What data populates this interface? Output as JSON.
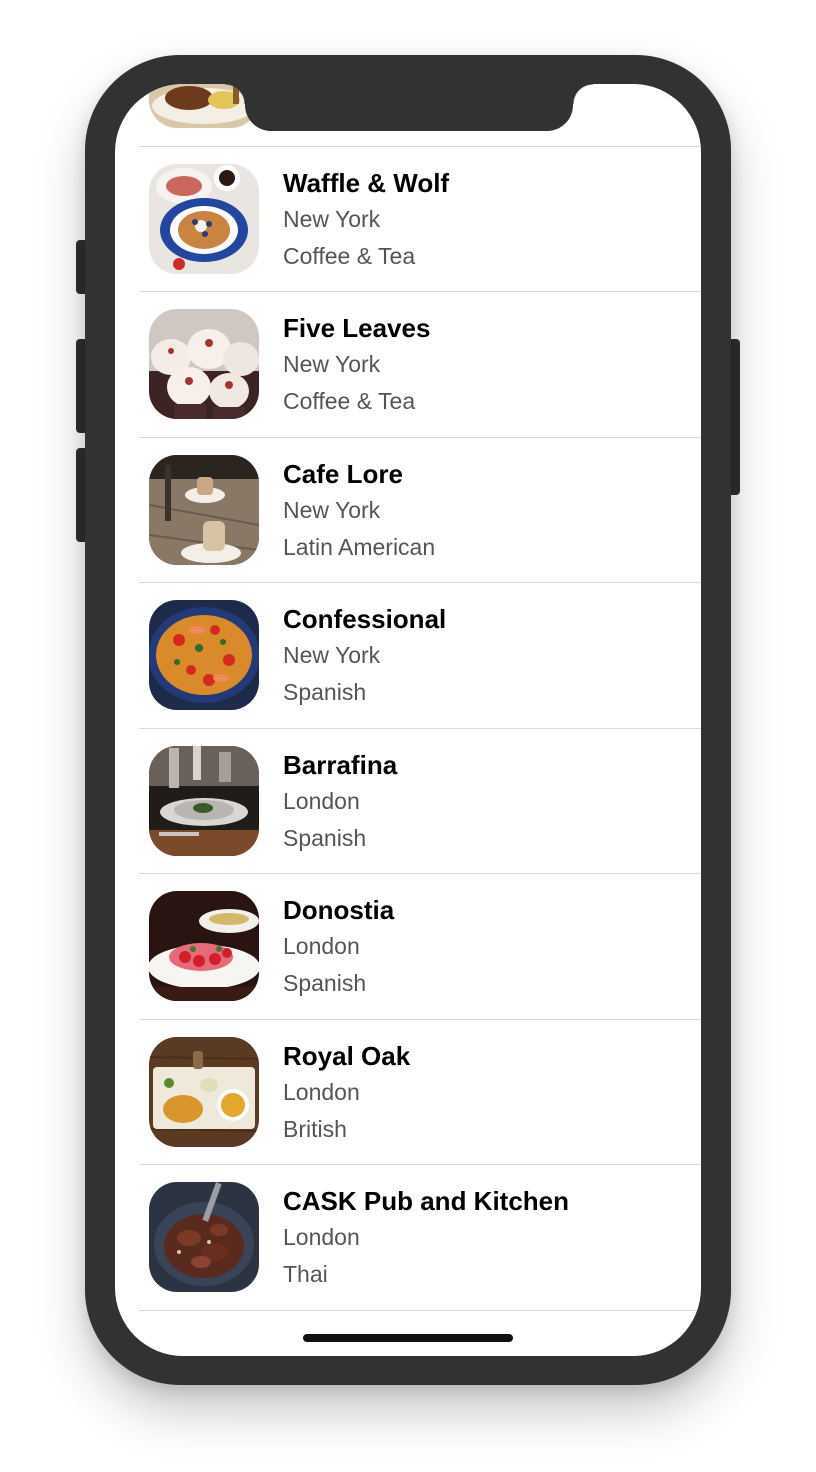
{
  "restaurants": [
    {
      "name": "",
      "city": "",
      "cuisine": "",
      "image": "food-photo-plate"
    },
    {
      "name": "Waffle & Wolf",
      "city": "New York",
      "cuisine": "Coffee & Tea",
      "image": "waffle-photo"
    },
    {
      "name": "Five Leaves",
      "city": "New York",
      "cuisine": "Coffee & Tea",
      "image": "cupcakes-photo"
    },
    {
      "name": "Cafe Lore",
      "city": "New York",
      "cuisine": "Latin American",
      "image": "coffee-table-photo"
    },
    {
      "name": "Confessional",
      "city": "New York",
      "cuisine": "Spanish",
      "image": "paella-photo"
    },
    {
      "name": "Barrafina",
      "city": "London",
      "cuisine": "Spanish",
      "image": "restaurant-plate-photo"
    },
    {
      "name": "Donostia",
      "city": "London",
      "cuisine": "Spanish",
      "image": "strawberry-dessert-photo"
    },
    {
      "name": "Royal Oak",
      "city": "London",
      "cuisine": "British",
      "image": "fish-and-chips-photo"
    },
    {
      "name": "CASK Pub and Kitchen",
      "city": "London",
      "cuisine": "Thai",
      "image": "meat-dish-photo"
    }
  ],
  "colors": {
    "device": "#323232",
    "name_text": "#000000",
    "secondary_text": "#555555",
    "separator": "#d9d9d9"
  }
}
